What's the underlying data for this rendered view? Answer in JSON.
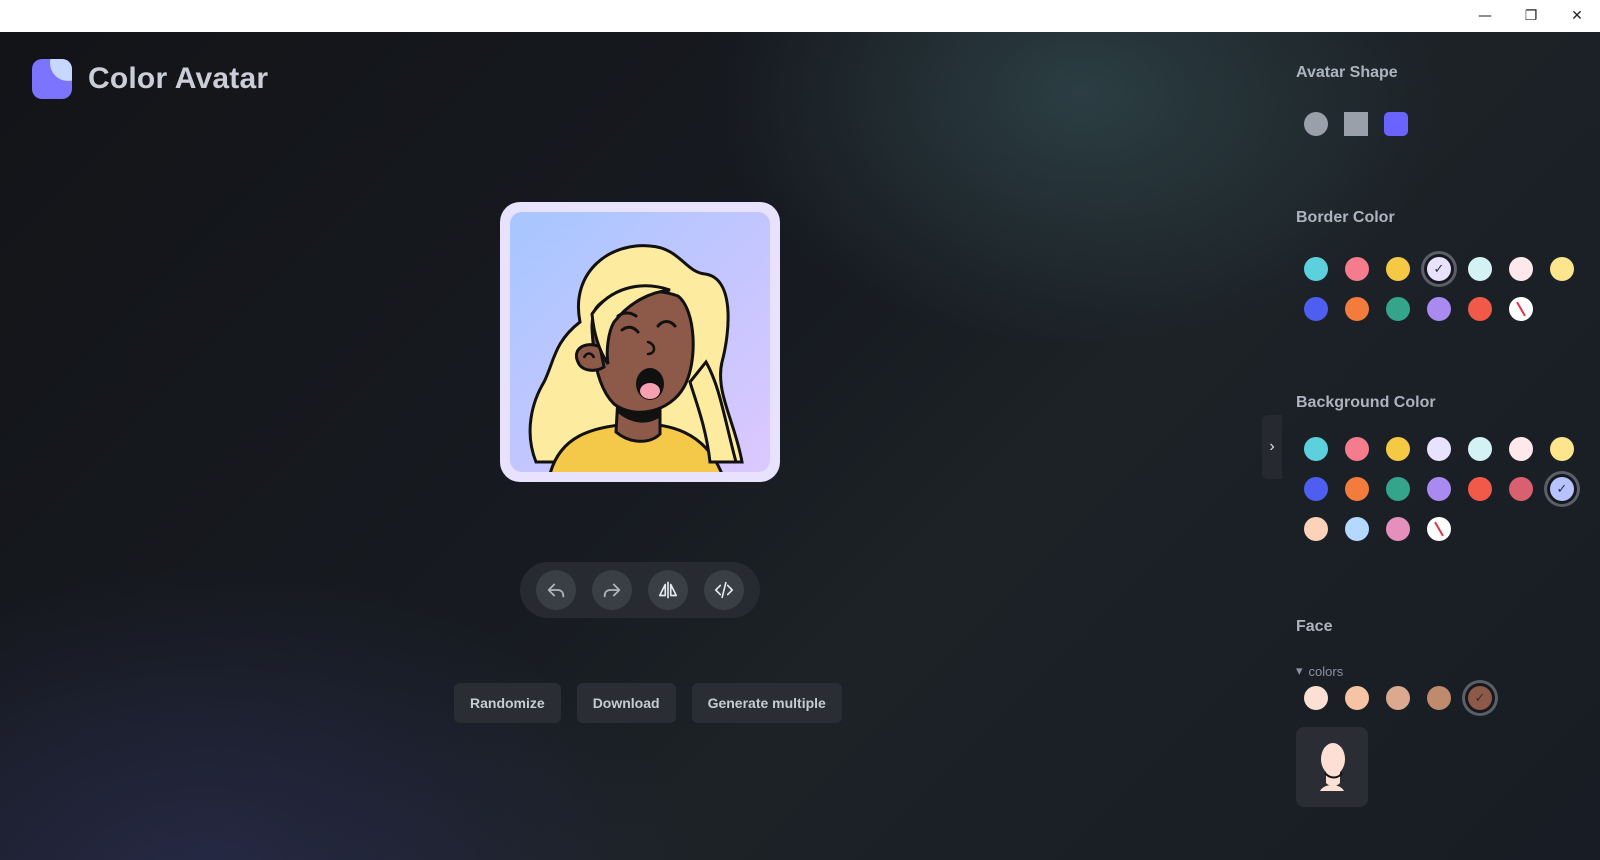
{
  "window": {
    "minimize_glyph": "—",
    "restore_glyph": "❐",
    "close_glyph": "✕"
  },
  "app": {
    "title": "Color Avatar"
  },
  "avatar": {
    "shape": "rounded-square",
    "border_color": "#e8e2ff",
    "background_color": "#b6c3ff",
    "skin_color": "#8d5a4a",
    "hair_color": "#fdeba0",
    "shirt_color": "#f4c94a"
  },
  "toolbar": {
    "undo_icon": "undo-icon",
    "redo_icon": "redo-icon",
    "flip_icon": "flip-icon",
    "code_icon": "code-icon"
  },
  "actions": {
    "randomize": "Randomize",
    "download": "Download",
    "generate_multiple": "Generate multiple"
  },
  "panel": {
    "collapse_glyph": "›",
    "avatar_shape": {
      "title": "Avatar Shape",
      "options": [
        {
          "name": "circle",
          "color": "#9aa0aa",
          "selected": false
        },
        {
          "name": "square",
          "color": "#9aa0aa",
          "selected": false
        },
        {
          "name": "squircle",
          "color": "#6b63ff",
          "selected": true
        }
      ]
    },
    "border_color": {
      "title": "Border Color",
      "swatches": [
        {
          "color": "#5cd1dd",
          "selected": false
        },
        {
          "color": "#f47c8c",
          "selected": false
        },
        {
          "color": "#f6c945",
          "selected": false
        },
        {
          "color": "#e8e2ff",
          "selected": true
        },
        {
          "color": "#d4f1f4",
          "selected": false
        },
        {
          "color": "#fde8ec",
          "selected": false
        },
        {
          "color": "#fde58e",
          "selected": false
        },
        {
          "color": "#4e5ef0",
          "selected": false
        },
        {
          "color": "#f37c3c",
          "selected": false
        },
        {
          "color": "#34a58a",
          "selected": false
        },
        {
          "color": "#a98af0",
          "selected": false
        },
        {
          "color": "#f15a49",
          "selected": false
        },
        {
          "color": "none",
          "selected": false
        }
      ]
    },
    "background_color": {
      "title": "Background Color",
      "swatches": [
        {
          "color": "#5cd1dd",
          "selected": false
        },
        {
          "color": "#f47c8c",
          "selected": false
        },
        {
          "color": "#f6c945",
          "selected": false
        },
        {
          "color": "#e8e2ff",
          "selected": false
        },
        {
          "color": "#d4f1f4",
          "selected": false
        },
        {
          "color": "#fde8ec",
          "selected": false
        },
        {
          "color": "#fde58e",
          "selected": false
        },
        {
          "color": "#4e5ef0",
          "selected": false
        },
        {
          "color": "#f37c3c",
          "selected": false
        },
        {
          "color": "#34a58a",
          "selected": false
        },
        {
          "color": "#a98af0",
          "selected": false
        },
        {
          "color": "#f15a49",
          "selected": false
        },
        {
          "color": "#d9606e",
          "selected": false
        },
        {
          "color": "#b6c3ff",
          "selected": true
        },
        {
          "color": "#fcd3b8",
          "selected": false
        },
        {
          "color": "#b4d8ff",
          "selected": false
        },
        {
          "color": "#e58fbc",
          "selected": false
        },
        {
          "color": "none",
          "selected": false
        }
      ]
    },
    "face": {
      "title": "Face",
      "colors_label": "colors",
      "toggle_glyph": "▾",
      "swatches": [
        {
          "color": "#fde0d3",
          "selected": false
        },
        {
          "color": "#f7c3a5",
          "selected": false
        },
        {
          "color": "#dba98f",
          "selected": false
        },
        {
          "color": "#c08a6c",
          "selected": false
        },
        {
          "color": "#8d5a4a",
          "selected": true
        }
      ]
    }
  }
}
